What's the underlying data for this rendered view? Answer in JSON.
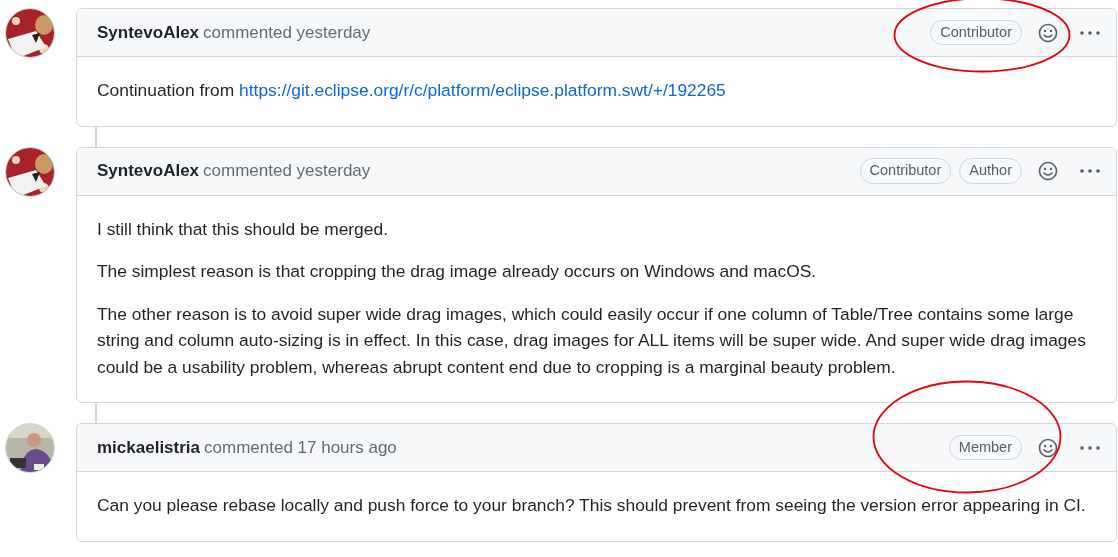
{
  "comments": [
    {
      "author": "SyntevoAlex",
      "action": "commented",
      "time": "yesterday",
      "badges": [
        "Contributor"
      ],
      "circled": true,
      "paragraphs": [
        {
          "text": "Continuation from ",
          "link": "https://git.eclipse.org/r/c/platform/eclipse.platform.swt/+/192265"
        }
      ]
    },
    {
      "author": "SyntevoAlex",
      "action": "commented",
      "time": "yesterday",
      "badges": [
        "Contributor",
        "Author"
      ],
      "circled": false,
      "paragraphs": [
        {
          "text": "I still think that this should be merged."
        },
        {
          "text": "The simplest reason is that cropping the drag image already occurs on Windows and macOS."
        },
        {
          "text": "The other reason is to avoid super wide drag images, which could easily occur if one column of Table/Tree contains some large string and column auto-sizing is in effect. In this case, drag images for ALL items will be super wide. And super wide drag images could be a usability problem, whereas abrupt content end due to cropping is a marginal beauty problem."
        }
      ]
    },
    {
      "author": "mickaelistria",
      "action": "commented",
      "time": "17 hours ago",
      "badges": [
        "Member"
      ],
      "circled": true,
      "paragraphs": [
        {
          "text": "Can you please rebase locally and push force to your branch? This should prevent from seeing the version error appearing in CI."
        }
      ]
    }
  ]
}
